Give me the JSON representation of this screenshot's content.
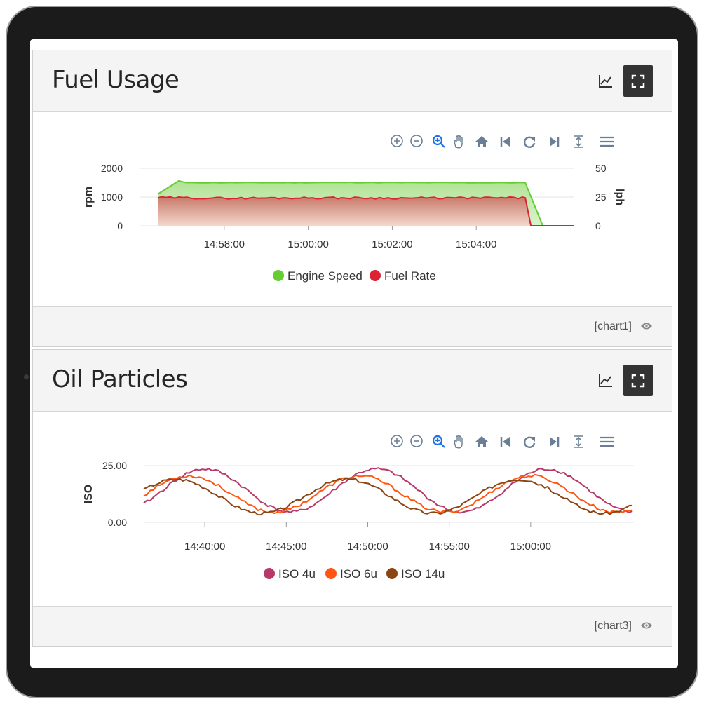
{
  "panels": [
    {
      "title": "Fuel Usage",
      "footer_label": "[chart1]",
      "chart_data": {
        "type": "area",
        "x_ticks": [
          "14:58:00",
          "15:00:00",
          "15:02:00",
          "15:04:00"
        ],
        "y_left": {
          "label": "rpm",
          "ticks": [
            "2000",
            "1000",
            "0"
          ],
          "range": [
            0,
            2000
          ]
        },
        "y_right": {
          "label": "lph",
          "ticks": [
            "50",
            "25",
            "0"
          ],
          "range": [
            0,
            50
          ]
        },
        "series": [
          {
            "name": "Engine Speed",
            "color": "#66cc33",
            "axis": "left",
            "points": [
              [
                "14:56:25",
                1100
              ],
              [
                "14:56:55",
                1560
              ],
              [
                "14:57:05",
                1500
              ],
              [
                "14:59:00",
                1500
              ],
              [
                "15:01:00",
                1505
              ],
              [
                "15:03:00",
                1500
              ],
              [
                "15:05:10",
                1500
              ],
              [
                "15:05:35",
                0
              ],
              [
                "15:06:20",
                0
              ]
            ]
          },
          {
            "name": "Fuel Rate",
            "color": "#dd2233",
            "axis": "right",
            "points": [
              [
                "14:56:25",
                24.5
              ],
              [
                "14:58:00",
                24
              ],
              [
                "15:00:00",
                24.3
              ],
              [
                "15:02:00",
                24.1
              ],
              [
                "15:04:00",
                24.2
              ],
              [
                "15:05:10",
                24.3
              ],
              [
                "15:05:18",
                0
              ],
              [
                "15:06:20",
                0
              ]
            ]
          }
        ]
      }
    },
    {
      "title": "Oil Particles",
      "footer_label": "[chart3]",
      "chart_data": {
        "type": "line",
        "x_ticks": [
          "14:40:00",
          "14:45:00",
          "14:50:00",
          "14:55:00",
          "15:00:00"
        ],
        "y_left": {
          "label": "ISO",
          "ticks": [
            "25.00",
            "0.00"
          ],
          "range": [
            0,
            25
          ]
        },
        "series": [
          {
            "name": "ISO 4u",
            "color": "#b8386a",
            "wave": {
              "mean": 14,
              "amp": 9.5,
              "period_min": 10.5,
              "peak_at": "14:40:00"
            }
          },
          {
            "name": "ISO 6u",
            "color": "#ff5511",
            "wave": {
              "mean": 12.5,
              "amp": 8,
              "period_min": 10.5,
              "peak_at": "14:39:00"
            }
          },
          {
            "name": "ISO 14u",
            "color": "#8b4513",
            "wave": {
              "mean": 11.5,
              "amp": 7.5,
              "period_min": 10.5,
              "peak_at": "14:38:15"
            }
          }
        ],
        "x_range": [
          "14:36:15",
          "15:06:20"
        ]
      }
    }
  ],
  "toolbar_icons": [
    "zoom-in-icon",
    "zoom-out-icon",
    "selection-zoom-icon",
    "pan-icon",
    "home-icon",
    "skip-back-icon",
    "reset-icon",
    "skip-forward-icon",
    "autoscale-icon",
    "menu-icon"
  ]
}
